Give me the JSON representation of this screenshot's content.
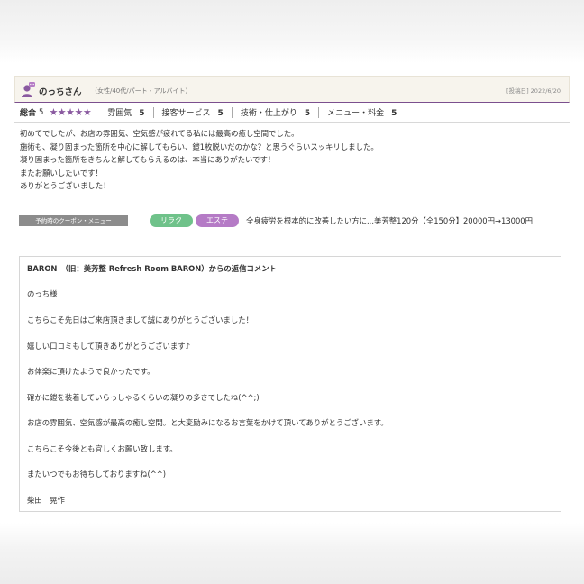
{
  "review": {
    "reviewer_name": "のっちさん",
    "reviewer_attr": "（女性/40代/パート・アルバイト）",
    "post_date": "[投稿日] 2022/6/20",
    "ratings": {
      "total_label": "総合",
      "total_value": "5",
      "stars": "★★★★★",
      "items": [
        {
          "label": "雰囲気",
          "value": "5"
        },
        {
          "label": "接客サービス",
          "value": "5"
        },
        {
          "label": "技術・仕上がり",
          "value": "5"
        },
        {
          "label": "メニュー・料金",
          "value": "5"
        }
      ]
    },
    "body_lines": [
      "初めてでしたが、お店の雰囲気、空気感が疲れてる私には最高の癒し空間でした。",
      "施術も、凝り固まった箇所を中心に解してもらい、鎧1枚脱いだのかな？と思うぐらいスッキリしました。",
      "凝り固まった箇所をきちんと解してもらえるのは、本当にありがたいです！",
      "またお願いしたいです！",
      "ありがとうございました！"
    ],
    "coupon_label": "予約時のクーポン・メニュー",
    "tags": [
      "リラク",
      "エステ"
    ],
    "coupon_text": "全身疲労を根本的に改善したい方に...美芳整120分【全150分】20000円→13000円"
  },
  "reply": {
    "title": "BARON　（旧：美芳整 Refresh Room BARON）からの返信コメント",
    "lines": [
      "のっち様",
      "こちらこそ先日はご来店頂きまして誠にありがとうございました！",
      "嬉しい口コミもして頂きありがとうございます♪",
      "お体楽に頂けたようで良かったです。",
      "確かに鎧を装着していらっしゃるくらいの凝りの多さでしたね(^^;)",
      "お店の雰囲気、空気感が最高の癒し空間。と大変励みになるお言葉をかけて頂いてありがとうございます。",
      "こちらこそ今後とも宜しくお願い致します。",
      "またいつでもお待ちしておりますね(^^)",
      "柴田　晃作"
    ]
  },
  "colors": {
    "accent": "#7b4f8e",
    "star": "#8a5aa0",
    "tag_relax": "#6fc28a",
    "tag_este": "#b57bc6",
    "coupon_label_bg": "#8c8c8c"
  },
  "icons": {
    "avatar": "reviewer-avatar-icon"
  }
}
